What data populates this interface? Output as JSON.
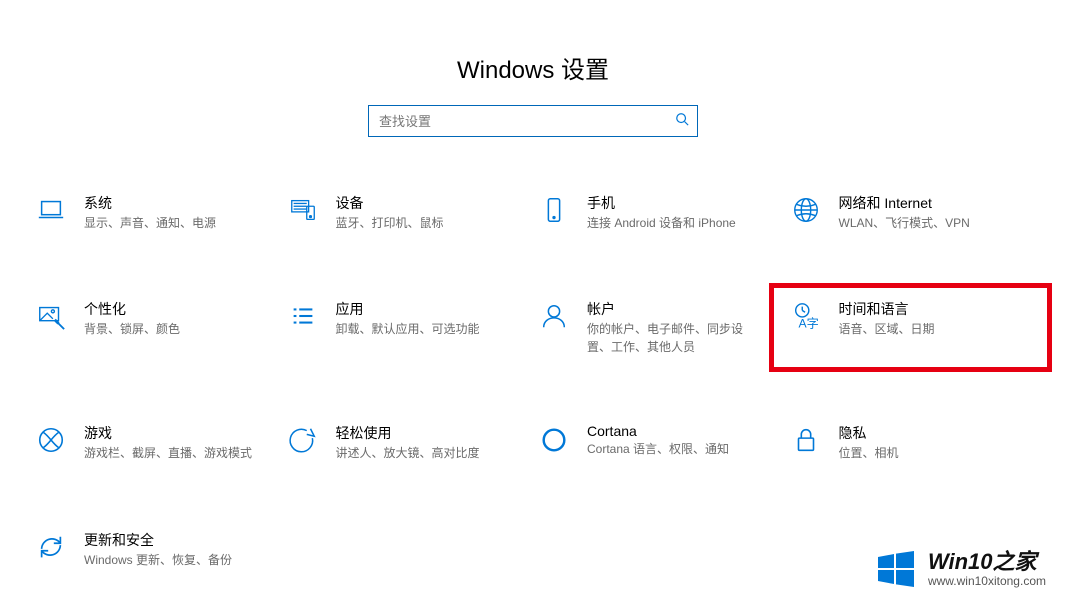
{
  "title": "Windows 设置",
  "search": {
    "placeholder": "查找设置"
  },
  "tiles": {
    "system": {
      "title": "系统",
      "desc": "显示、声音、通知、电源"
    },
    "devices": {
      "title": "设备",
      "desc": "蓝牙、打印机、鼠标"
    },
    "phone": {
      "title": "手机",
      "desc": "连接 Android 设备和 iPhone"
    },
    "network": {
      "title": "网络和 Internet",
      "desc": "WLAN、飞行模式、VPN"
    },
    "personalize": {
      "title": "个性化",
      "desc": "背景、锁屏、颜色"
    },
    "apps": {
      "title": "应用",
      "desc": "卸载、默认应用、可选功能"
    },
    "accounts": {
      "title": "帐户",
      "desc": "你的帐户、电子邮件、同步设置、工作、其他人员"
    },
    "time_language": {
      "title": "时间和语言",
      "desc": "语音、区域、日期"
    },
    "gaming": {
      "title": "游戏",
      "desc": "游戏栏、截屏、直播、游戏模式"
    },
    "ease": {
      "title": "轻松使用",
      "desc": "讲述人、放大镜、高对比度"
    },
    "cortana": {
      "title": "Cortana",
      "desc": "Cortana 语言、权限、通知"
    },
    "privacy": {
      "title": "隐私",
      "desc": "位置、相机"
    },
    "update": {
      "title": "更新和安全",
      "desc": "Windows 更新、恢复、备份"
    }
  },
  "watermark": {
    "site": "Win10之家",
    "url": "www.win10xitong.com"
  },
  "colors": {
    "accent": "#0078d7",
    "highlight": "#e60012"
  }
}
